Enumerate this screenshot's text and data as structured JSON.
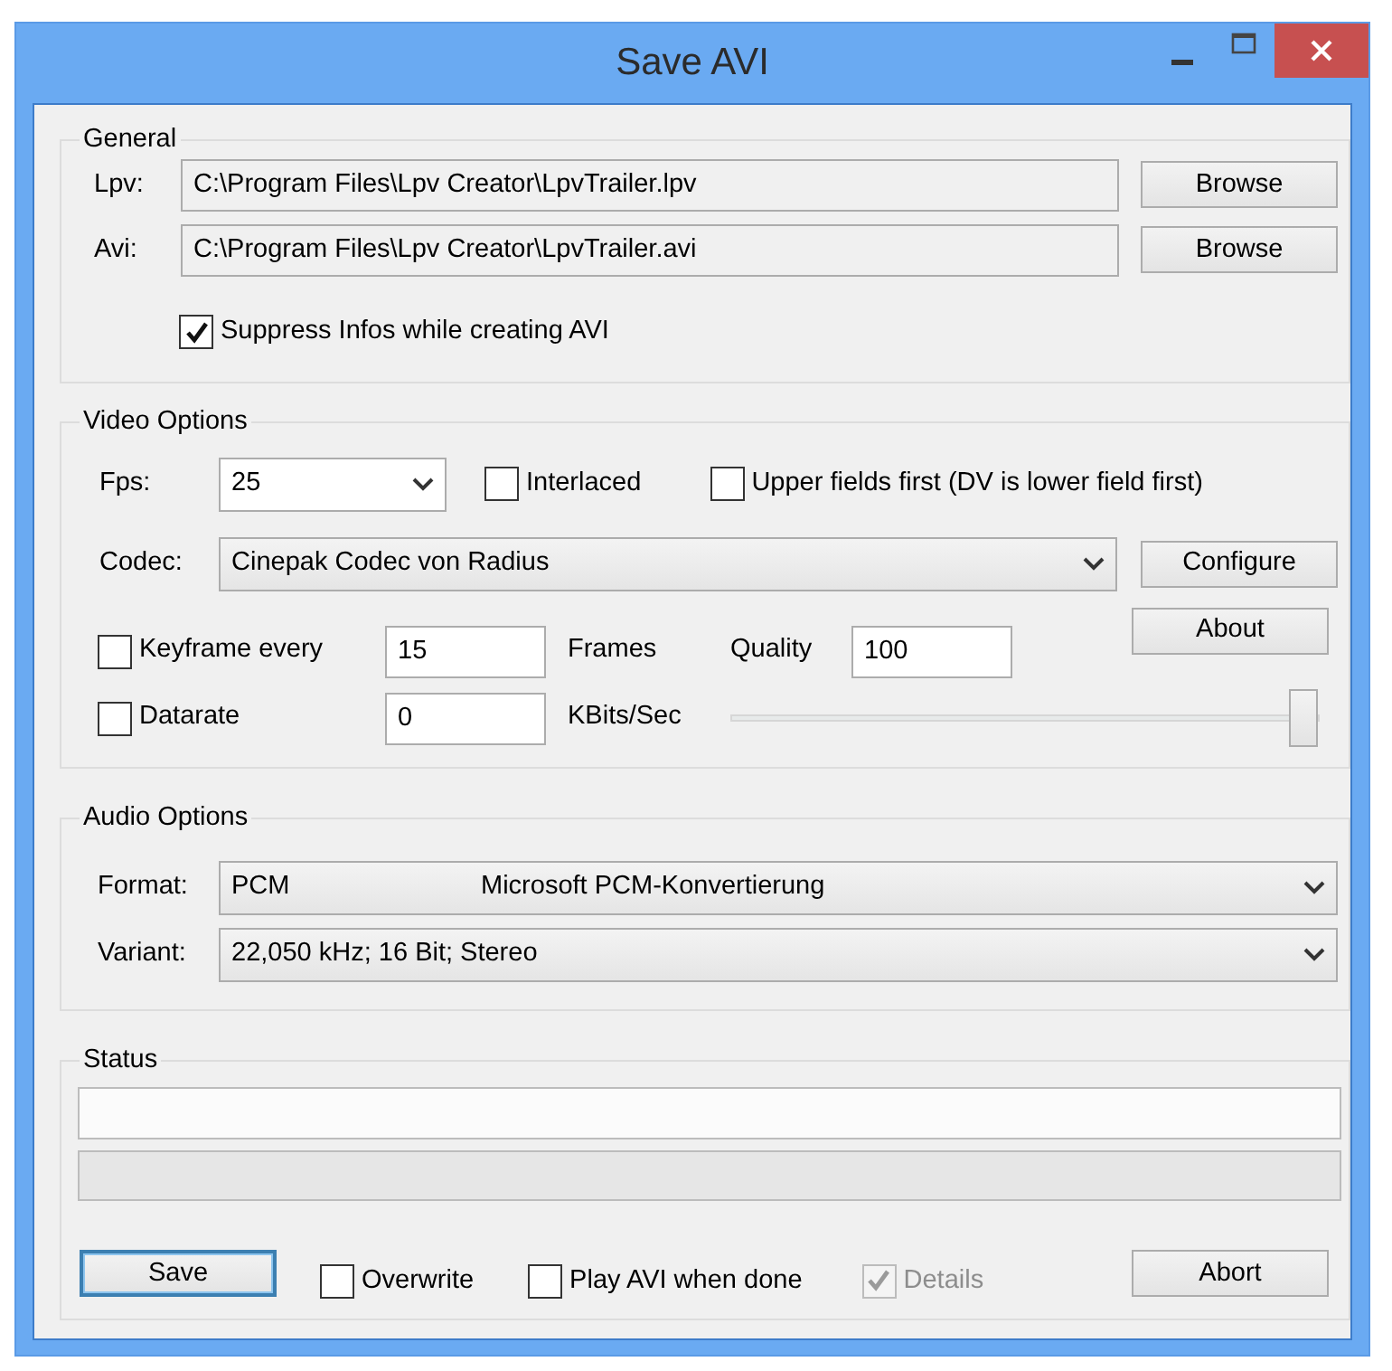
{
  "window": {
    "title": "Save AVI"
  },
  "general": {
    "title": "General",
    "files": [
      {
        "label": "Lpv:",
        "value": "C:\\Program Files\\Lpv Creator\\LpvTrailer.lpv",
        "button": "Browse"
      },
      {
        "label": "Avi:",
        "value": "C:\\Program Files\\Lpv Creator\\LpvTrailer.avi",
        "button": "Browse"
      }
    ],
    "suppress": {
      "label": "Suppress Infos while creating AVI",
      "checked": true
    }
  },
  "video": {
    "title": "Video Options",
    "fps": {
      "label": "Fps:",
      "value": "25"
    },
    "interlaced": {
      "label": "Interlaced",
      "checked": false
    },
    "upper_fields": {
      "label": "Upper fields first (DV is lower field first)",
      "checked": false
    },
    "codec": {
      "label": "Codec:",
      "value": "Cinepak Codec von Radius"
    },
    "configure_button": "Configure",
    "about_button": "About",
    "keyframe": {
      "label": "Keyframe every",
      "checked": false,
      "value": "15",
      "unit": "Frames"
    },
    "quality": {
      "label": "Quality",
      "value": "100"
    },
    "datarate": {
      "label": "Datarate",
      "checked": false,
      "value": "0",
      "unit": "KBits/Sec"
    },
    "slider": {
      "level": 1
    }
  },
  "audio": {
    "title": "Audio Options",
    "rows": [
      {
        "label": "Format:",
        "value": "PCM",
        "detail": "Microsoft PCM-Konvertierung"
      },
      {
        "label": "Variant:",
        "value": "22,050 kHz; 16 Bit; Stereo"
      }
    ]
  },
  "status": {
    "title": "Status",
    "progress": {
      "level": 0
    },
    "save_button": "Save",
    "abort_button": "Abort",
    "options": [
      {
        "label": "Overwrite",
        "checked": false,
        "disabled": false
      },
      {
        "label": "Play AVI when done",
        "checked": false,
        "disabled": false
      },
      {
        "label": "Details",
        "checked": true,
        "disabled": true
      }
    ]
  }
}
